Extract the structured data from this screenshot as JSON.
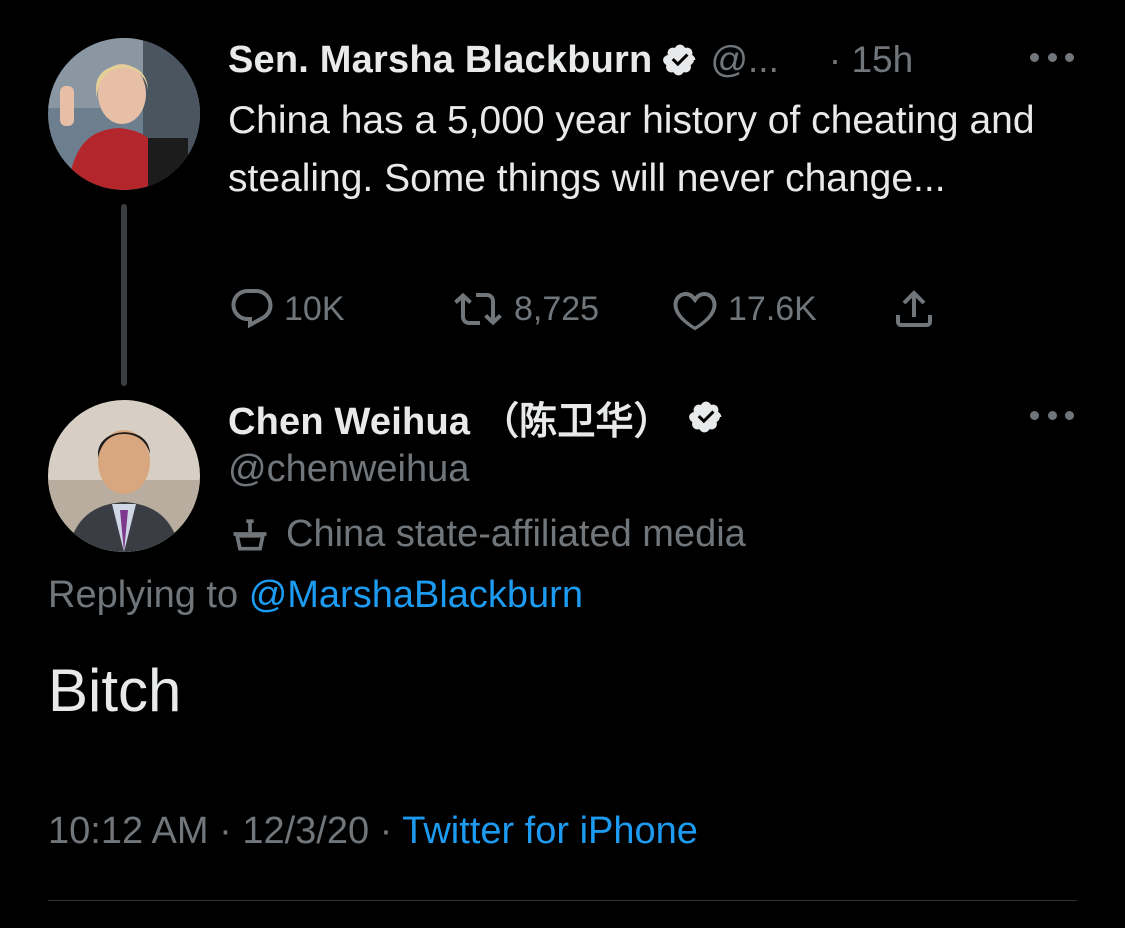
{
  "parent_tweet": {
    "display_name": "Sen. Marsha Blackburn",
    "handle": "@...",
    "time": "· 15h",
    "text": "China has a 5,000 year history of cheating and stealing. Some things will never change...",
    "replies": "10K",
    "retweets": "8,725",
    "likes": "17.6K"
  },
  "reply_tweet": {
    "display_name": "Chen Weihua （陈卫华）",
    "handle": "@chenweihua",
    "account_label": "China state-affiliated media",
    "replying_prefix": "Replying to",
    "replying_to": "@MarshaBlackburn",
    "text": "Bitch",
    "timestamp": "10:12 AM · 12/3/20 ·",
    "source": "Twitter for iPhone"
  },
  "colors": {
    "background": "#000000",
    "primary_text": "#e7e9ea",
    "secondary_text": "#71767b",
    "link": "#1d9bf0",
    "thread_line": "#3a3d40"
  },
  "icons": [
    "verified-badge-icon",
    "more-icon",
    "reply-icon",
    "retweet-icon",
    "like-icon",
    "share-icon",
    "state-media-icon"
  ]
}
